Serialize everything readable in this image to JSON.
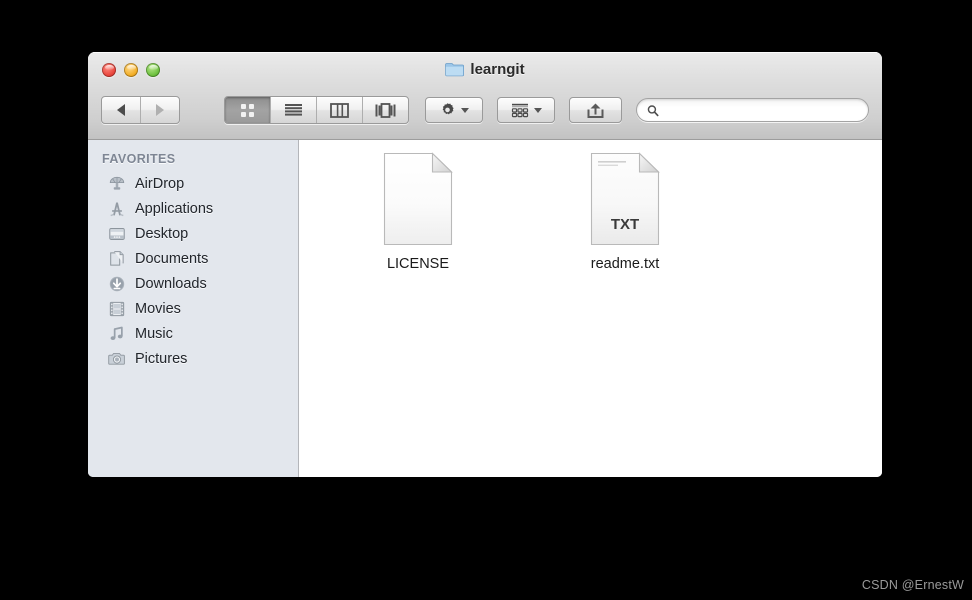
{
  "window": {
    "title": "learngit",
    "title_icon": "folder-icon",
    "traffic_lights": [
      {
        "name": "close-button",
        "color": "#e8453c"
      },
      {
        "name": "minimize-button",
        "color": "#f2ad25"
      },
      {
        "name": "zoom-button",
        "color": "#6cc03d"
      }
    ]
  },
  "toolbar": {
    "back_label": "Back",
    "forward_label": "Forward",
    "view_modes": [
      {
        "id": "icon-view",
        "label": "Icon View",
        "icon": "grid-icon",
        "selected": true
      },
      {
        "id": "list-view",
        "label": "List View",
        "icon": "list-icon",
        "selected": false
      },
      {
        "id": "column-view",
        "label": "Column View",
        "icon": "columns-icon",
        "selected": false
      },
      {
        "id": "coverflow-view",
        "label": "Cover Flow",
        "icon": "coverflow-icon",
        "selected": false
      }
    ],
    "action_label": "Action",
    "action_icon": "gear-icon",
    "arrange_label": "Arrange By",
    "arrange_icon": "arrange-grid-icon",
    "share_label": "Share",
    "share_icon": "share-arrow-icon"
  },
  "search": {
    "value": "",
    "placeholder": "",
    "icon": "search-icon"
  },
  "sidebar": {
    "header": "FAVORITES",
    "items": [
      {
        "label": "AirDrop",
        "icon": "airdrop-icon"
      },
      {
        "label": "Applications",
        "icon": "applications-icon"
      },
      {
        "label": "Desktop",
        "icon": "desktop-icon"
      },
      {
        "label": "Documents",
        "icon": "documents-icon"
      },
      {
        "label": "Downloads",
        "icon": "downloads-icon"
      },
      {
        "label": "Movies",
        "icon": "movies-icon"
      },
      {
        "label": "Music",
        "icon": "music-icon"
      },
      {
        "label": "Pictures",
        "icon": "pictures-icon"
      }
    ]
  },
  "content": {
    "files": [
      {
        "name": "LICENSE",
        "icon": "blank-document-icon",
        "badge": ""
      },
      {
        "name": "readme.txt",
        "icon": "text-document-icon",
        "badge": "TXT"
      }
    ]
  },
  "watermark": "CSDN @ErnestW",
  "colors": {
    "desktop_background": "#000000",
    "sidebar_background": "#e3e7ed",
    "content_background": "#ffffff",
    "titlebar_top": "#ebebeb",
    "titlebar_bottom": "#c2c2c2",
    "sidebar_header_text": "#7e8694"
  }
}
